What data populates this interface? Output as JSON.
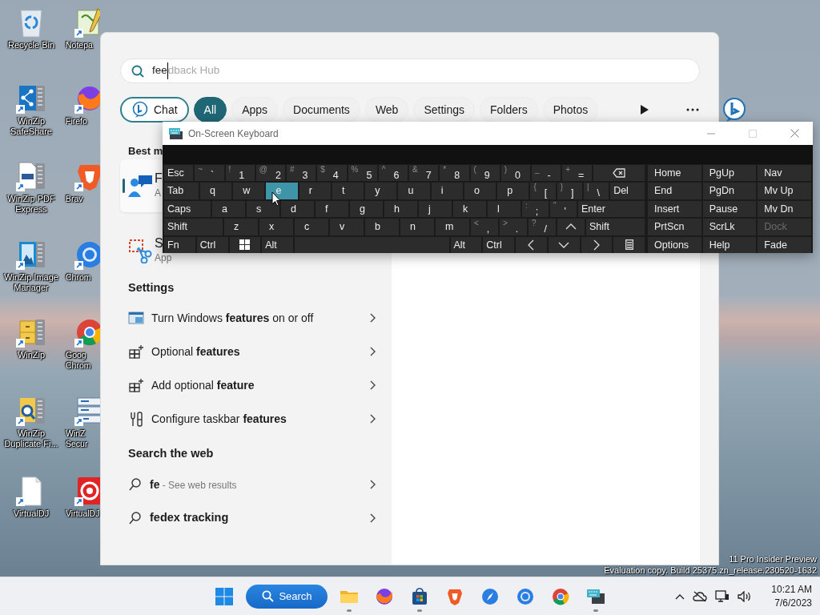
{
  "desktop_icons": [
    {
      "label": "Recycle Bin",
      "shortcut": false
    },
    {
      "label": "WinZip SafeShare",
      "shortcut": true
    },
    {
      "label": "WinZip PDF Express",
      "shortcut": true
    },
    {
      "label": "WinZip Image Manager",
      "shortcut": true
    },
    {
      "label": "WinZip",
      "shortcut": true
    },
    {
      "label": "WinZip Duplicate Fi...",
      "shortcut": true
    },
    {
      "label": "VirtualDJ",
      "shortcut": true
    }
  ],
  "desktop_icons_column_2": [
    {
      "label": "Notepa",
      "shortcut": true
    },
    {
      "label": "Firefo",
      "shortcut": true
    },
    {
      "label": "Brav",
      "shortcut": true
    },
    {
      "label": "Chrom",
      "shortcut": true
    },
    {
      "label": "Goog Chrom",
      "shortcut": true
    },
    {
      "label": "WinZ Secur",
      "shortcut": true
    },
    {
      "label": "VirtualDJ",
      "shortcut": true
    }
  ],
  "search_panel": {
    "search": {
      "value": "fee",
      "suggestion": "dback Hub"
    },
    "filters": [
      {
        "kind": "chat",
        "label": "Chat",
        "selected": false
      },
      {
        "kind": "filter",
        "label": "All",
        "selected": true
      },
      {
        "kind": "filter",
        "label": "Apps",
        "selected": false
      },
      {
        "kind": "filter",
        "label": "Documents",
        "selected": false
      },
      {
        "kind": "filter",
        "label": "Web",
        "selected": false
      },
      {
        "kind": "filter",
        "label": "Settings",
        "selected": false
      },
      {
        "kind": "filter",
        "label": "Folders",
        "selected": false
      },
      {
        "kind": "filter",
        "label": "Photos",
        "selected": false
      }
    ],
    "best_match": {
      "heading": "Best m",
      "items": [
        {
          "title": "F",
          "subtitle": "A",
          "selected": true
        },
        {
          "title": "S",
          "subtitle": "App",
          "selected": false
        }
      ]
    },
    "settings": {
      "heading": "Settings",
      "items": [
        {
          "label": "Turn Windows **features** on or off"
        },
        {
          "label": "Optional **features**"
        },
        {
          "label": "Add optional **feature**"
        },
        {
          "label": "Configure taskbar **features**"
        }
      ]
    },
    "web": {
      "heading": "Search the web",
      "items": [
        {
          "query": "fe",
          "hint": "- See web results"
        },
        {
          "query": "fedex tracking"
        }
      ]
    }
  },
  "keyboard": {
    "title": "On-Screen Keyboard",
    "rows": [
      {
        "keys": [
          {
            "kind": "text",
            "label": "Esc",
            "highlighted": false
          },
          {
            "kind": "dual",
            "shift": "~",
            "label": "`",
            "highlighted": false
          },
          {
            "kind": "dual",
            "shift": "!",
            "label": "1",
            "highlighted": false
          },
          {
            "kind": "dual",
            "shift": "@",
            "label": "2",
            "highlighted": false
          },
          {
            "kind": "dual",
            "shift": "#",
            "label": "3",
            "highlighted": false
          },
          {
            "kind": "dual",
            "shift": "$",
            "label": "4",
            "highlighted": false
          },
          {
            "kind": "dual",
            "shift": "%",
            "label": "5",
            "highlighted": false
          },
          {
            "kind": "dual",
            "shift": "^",
            "label": "6",
            "highlighted": false
          },
          {
            "kind": "dual",
            "shift": "&",
            "label": "7",
            "highlighted": false
          },
          {
            "kind": "dual",
            "shift": "*",
            "label": "8",
            "highlighted": false
          },
          {
            "kind": "dual",
            "shift": "(",
            "label": "9",
            "highlighted": false
          },
          {
            "kind": "dual",
            "shift": ")",
            "label": "0",
            "highlighted": false
          },
          {
            "kind": "dual",
            "shift": "_",
            "label": "-",
            "highlighted": false
          },
          {
            "kind": "dual",
            "shift": "+",
            "label": "=",
            "highlighted": false
          },
          {
            "kind": "backspace",
            "highlighted": false
          }
        ]
      },
      {
        "keys": [
          {
            "kind": "text",
            "label": "Tab",
            "highlighted": false
          },
          {
            "kind": "char",
            "label": "q",
            "highlighted": false
          },
          {
            "kind": "char",
            "label": "w",
            "highlighted": false
          },
          {
            "kind": "char",
            "label": "e",
            "highlighted": true
          },
          {
            "kind": "char",
            "label": "r",
            "highlighted": false
          },
          {
            "kind": "char",
            "label": "t",
            "highlighted": false
          },
          {
            "kind": "char",
            "label": "y",
            "highlighted": false
          },
          {
            "kind": "char",
            "label": "u",
            "highlighted": false
          },
          {
            "kind": "char",
            "label": "i",
            "highlighted": false
          },
          {
            "kind": "char",
            "label": "o",
            "highlighted": false
          },
          {
            "kind": "char",
            "label": "p",
            "highlighted": false
          },
          {
            "kind": "dual",
            "shift": "{",
            "label": "[",
            "highlighted": false
          },
          {
            "kind": "dual",
            "shift": "}",
            "label": "]",
            "highlighted": false
          },
          {
            "kind": "dual",
            "shift": "|",
            "label": "\\",
            "highlighted": false
          },
          {
            "kind": "text",
            "label": "Del",
            "highlighted": false
          }
        ]
      },
      {
        "keys": [
          {
            "kind": "text",
            "label": "Caps",
            "highlighted": false
          },
          {
            "kind": "char",
            "label": "a",
            "highlighted": false
          },
          {
            "kind": "char",
            "label": "s",
            "highlighted": false
          },
          {
            "kind": "char",
            "label": "d",
            "highlighted": false
          },
          {
            "kind": "char",
            "label": "f",
            "highlighted": false
          },
          {
            "kind": "char",
            "label": "g",
            "highlighted": false
          },
          {
            "kind": "char",
            "label": "h",
            "highlighted": false
          },
          {
            "kind": "char",
            "label": "j",
            "highlighted": false
          },
          {
            "kind": "char",
            "label": "k",
            "highlighted": false
          },
          {
            "kind": "char",
            "label": "l",
            "highlighted": false
          },
          {
            "kind": "dual",
            "shift": ":",
            "label": ";",
            "highlighted": false
          },
          {
            "kind": "dual",
            "shift": "\"",
            "label": "'",
            "highlighted": false
          },
          {
            "kind": "text",
            "label": "Enter",
            "highlighted": false
          }
        ]
      },
      {
        "keys": [
          {
            "kind": "text",
            "label": "Shift",
            "highlighted": false
          },
          {
            "kind": "char",
            "label": "z",
            "highlighted": false
          },
          {
            "kind": "char",
            "label": "x",
            "highlighted": false
          },
          {
            "kind": "char",
            "label": "c",
            "highlighted": false
          },
          {
            "kind": "char",
            "label": "v",
            "highlighted": false
          },
          {
            "kind": "char",
            "label": "b",
            "highlighted": false
          },
          {
            "kind": "char",
            "label": "n",
            "highlighted": false
          },
          {
            "kind": "char",
            "label": "m",
            "highlighted": false
          },
          {
            "kind": "dual",
            "shift": "<",
            "label": ",",
            "highlighted": false
          },
          {
            "kind": "dual",
            "shift": ">",
            "label": ".",
            "highlighted": false
          },
          {
            "kind": "dual",
            "shift": "?",
            "label": "/",
            "highlighted": false
          },
          {
            "kind": "up",
            "highlighted": false
          },
          {
            "kind": "text",
            "label": "Shift",
            "highlighted": false
          }
        ]
      },
      {
        "keys": [
          {
            "kind": "text",
            "label": "Fn",
            "highlighted": false
          },
          {
            "kind": "text",
            "label": "Ctrl",
            "highlighted": false
          },
          {
            "kind": "windows",
            "highlighted": false
          },
          {
            "kind": "text",
            "label": "Alt",
            "highlighted": false
          },
          {
            "kind": "space",
            "highlighted": false
          },
          {
            "kind": "text",
            "label": "Alt",
            "highlighted": false
          },
          {
            "kind": "text",
            "label": "Ctrl",
            "highlighted": false
          },
          {
            "kind": "left",
            "highlighted": false
          },
          {
            "kind": "down",
            "highlighted": false
          },
          {
            "kind": "right",
            "highlighted": false
          },
          {
            "kind": "menu",
            "highlighted": false
          }
        ]
      }
    ],
    "nav_rows": [
      [
        {
          "label": "Home",
          "disabled": false
        },
        {
          "label": "PgUp",
          "disabled": false
        },
        {
          "label": "Nav",
          "disabled": false
        }
      ],
      [
        {
          "label": "End",
          "disabled": false
        },
        {
          "label": "PgDn",
          "disabled": false
        },
        {
          "label": "Mv Up",
          "disabled": false
        }
      ],
      [
        {
          "label": "Insert",
          "disabled": false
        },
        {
          "label": "Pause",
          "disabled": false
        },
        {
          "label": "Mv Dn",
          "disabled": false
        }
      ],
      [
        {
          "label": "PrtScn",
          "disabled": false
        },
        {
          "label": "ScrLk",
          "disabled": false
        },
        {
          "label": "Dock",
          "disabled": true
        }
      ],
      [
        {
          "label": "Options",
          "disabled": false
        },
        {
          "label": "Help",
          "disabled": false
        },
        {
          "label": "Fade",
          "disabled": false
        }
      ]
    ]
  },
  "build_info": [
    "11 Pro Insider Preview",
    "Evaluation copy. Build 25375.zn_release.230520-1632"
  ],
  "taskbar": {
    "search_label": "Search",
    "apps": [
      {
        "running": true
      },
      {
        "running": false
      },
      {
        "running": true
      },
      {
        "running": false
      },
      {
        "running": false
      },
      {
        "running": false
      },
      {
        "running": false
      },
      {
        "running": true
      }
    ],
    "clock": {
      "time": "10:21 AM",
      "date": "7/6/2023"
    }
  }
}
